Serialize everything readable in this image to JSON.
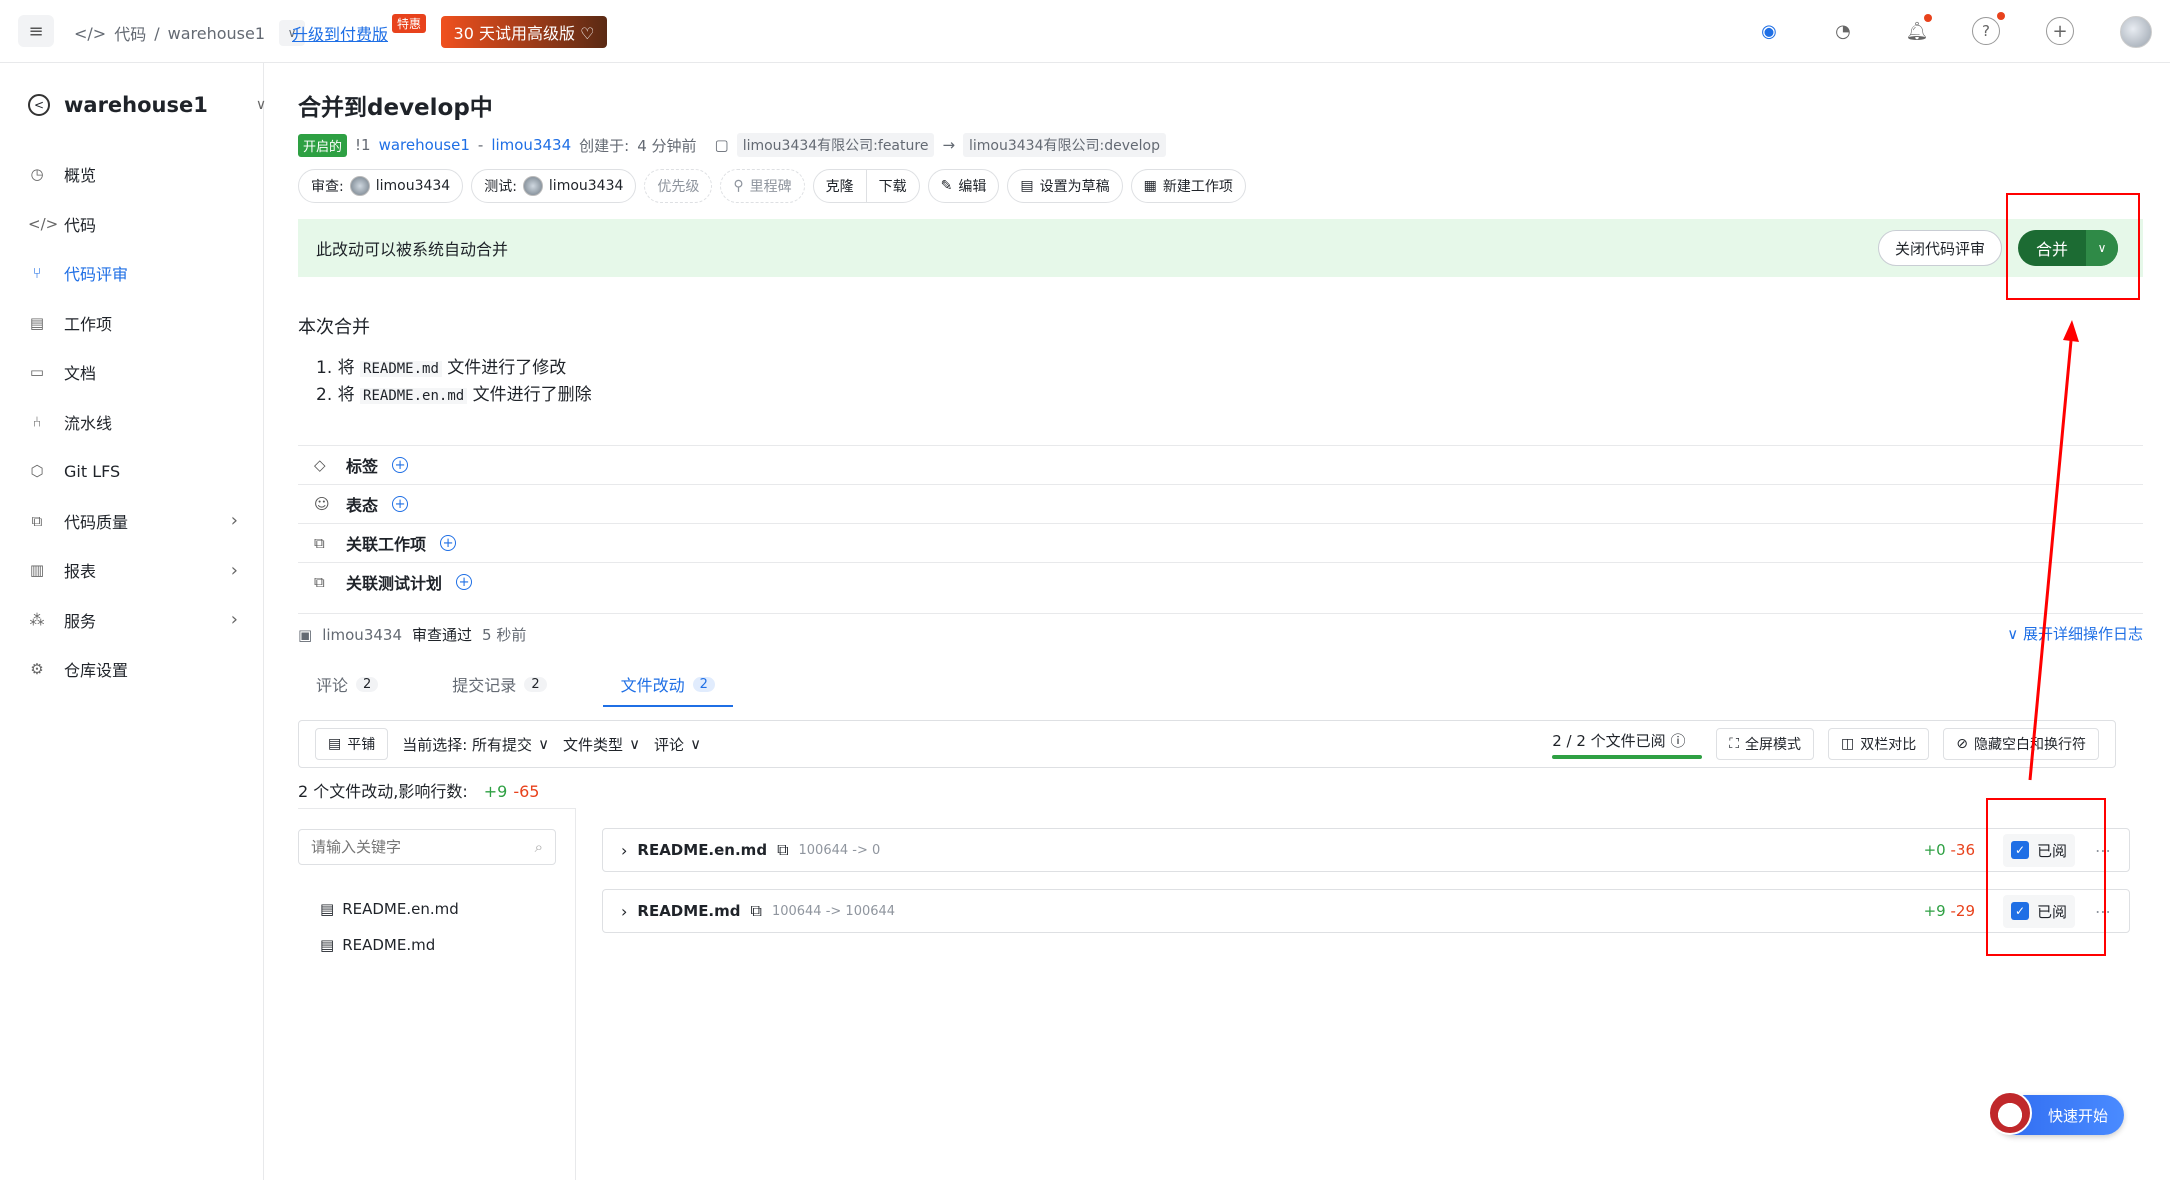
{
  "topbar": {
    "crumb_code": "代码",
    "crumb_sep": "/",
    "crumb_repo": "warehouse1",
    "upgrade": "升级到付费版",
    "hot": "特惠",
    "trial": "30 天试用高级版 ♡"
  },
  "sidebar": {
    "repo": "warehouse1",
    "items": [
      {
        "label": "概览",
        "icon": "dashboard-icon"
      },
      {
        "label": "代码",
        "icon": "code-icon"
      },
      {
        "label": "代码评审",
        "icon": "merge-request-icon",
        "active": true
      },
      {
        "label": "工作项",
        "icon": "workitem-icon"
      },
      {
        "label": "文档",
        "icon": "book-icon"
      },
      {
        "label": "流水线",
        "icon": "pipeline-icon"
      },
      {
        "label": "Git LFS",
        "icon": "cube-icon"
      },
      {
        "label": "代码质量",
        "icon": "quality-icon",
        "arrow": true
      },
      {
        "label": "报表",
        "icon": "chart-icon",
        "arrow": true
      },
      {
        "label": "服务",
        "icon": "service-icon",
        "arrow": true
      },
      {
        "label": "仓库设置",
        "icon": "gear-icon"
      }
    ]
  },
  "mr": {
    "title": "合并到develop中",
    "status": "开启的",
    "id": "!1",
    "repo": "warehouse1",
    "dash": "-",
    "author": "limou3434",
    "created_label": "创建于:",
    "created": "4 分钟前",
    "source_branch": "limou3434有限公司:feature",
    "arrow": "→",
    "target_branch": "limou3434有限公司:develop"
  },
  "chips": {
    "reviewer_label": "审查:",
    "reviewer": "limou3434",
    "tester_label": "测试:",
    "tester": "limou3434",
    "priority": "优先级",
    "milestone": "里程碑",
    "clone": "克隆",
    "download": "下载",
    "edit": "编辑",
    "draft": "设置为草稿",
    "new_item": "新建工作项"
  },
  "mergebar": {
    "text": "此改动可以被系统自动合并",
    "close": "关闭代码评审",
    "merge": "合并"
  },
  "desc": {
    "heading": "本次合并",
    "items": [
      {
        "pre": "将 ",
        "code": "README.md",
        "post": " 文件进行了修改"
      },
      {
        "pre": "将 ",
        "code": "README.en.md",
        "post": " 文件进行了删除"
      }
    ]
  },
  "attrs": [
    {
      "label": "标签"
    },
    {
      "label": "表态"
    },
    {
      "label": "关联工作项"
    },
    {
      "label": "关联测试计划"
    }
  ],
  "review": {
    "user": "limou3434",
    "action": "审查通过",
    "time": "5 秒前",
    "expand": "展开详细操作日志"
  },
  "tabs": [
    {
      "label": "评论",
      "count": "2"
    },
    {
      "label": "提交记录",
      "count": "2"
    },
    {
      "label": "文件改动",
      "count": "2",
      "active": true
    }
  ],
  "toolbar": {
    "flat": "平铺",
    "selection": "当前选择: 所有提交",
    "filetype": "文件类型",
    "comment": "评论",
    "read_progress": "2 / 2 个文件已阅",
    "fullscreen": "全屏模式",
    "sidebyside": "双栏对比",
    "hide_ws": "隐藏空白和换行符"
  },
  "summary": {
    "text": "2 个文件改动,影响行数:",
    "add": "+9",
    "del": "-65"
  },
  "search_placeholder": "请输入关键字",
  "files": [
    {
      "name": "README.en.md",
      "mode": "100644 -> 0",
      "add": "+0",
      "del": "-36",
      "read": "已阅"
    },
    {
      "name": "README.md",
      "mode": "100644 -> 100644",
      "add": "+9",
      "del": "-29",
      "read": "已阅"
    }
  ],
  "tree": [
    "README.en.md",
    "README.md"
  ],
  "quick": "快速开始"
}
